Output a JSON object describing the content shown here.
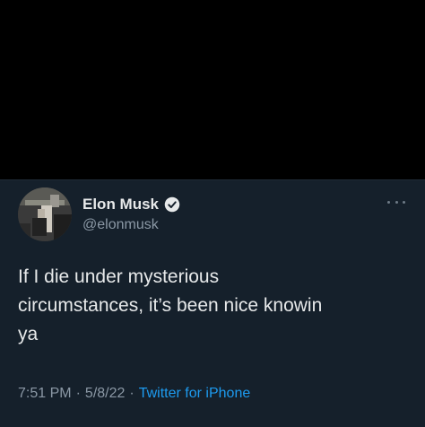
{
  "tweet": {
    "display_name": "Elon Musk",
    "handle": "@elonmusk",
    "text": "If I die under mysterious\ncircumstances, it’s been nice knowin\nya",
    "time": "7:51 PM",
    "date": "5/8/22",
    "separator": "·",
    "source": "Twitter for iPhone"
  },
  "icons": {
    "verified": "verified-badge-icon",
    "more": "more-options-icon",
    "avatar": "profile-avatar"
  },
  "colors": {
    "background": "#15202b",
    "text_primary": "#e7e9ea",
    "text_secondary": "#8b98a5",
    "accent": "#1d9bf0"
  }
}
